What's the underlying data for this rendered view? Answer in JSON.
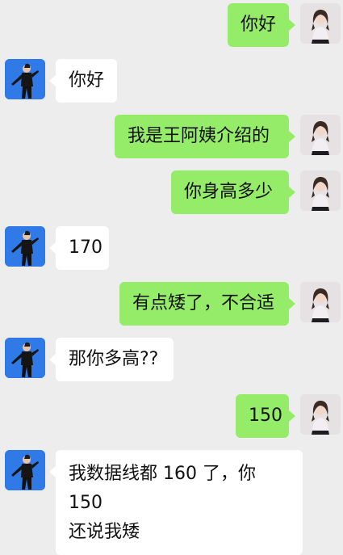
{
  "messages": [
    {
      "side": "right",
      "text": "你好"
    },
    {
      "side": "left",
      "text": "你好"
    },
    {
      "side": "right",
      "text": "我是王阿姨介绍的"
    },
    {
      "side": "right",
      "text": "你身高多少"
    },
    {
      "side": "left",
      "text": "170"
    },
    {
      "side": "right",
      "text": "有点矮了，不合适"
    },
    {
      "side": "left",
      "text": "那你多高??"
    },
    {
      "side": "right",
      "text": "150"
    },
    {
      "side": "left",
      "line1": "我数据线都 160 了，你 150",
      "line2": "还说我矮"
    }
  ],
  "colors": {
    "background": "#ededed",
    "my_bubble": "#95ec69",
    "other_bubble": "#ffffff"
  },
  "icons": {
    "me_avatar": "girl-avatar",
    "other_avatar": "boy-avatar"
  }
}
